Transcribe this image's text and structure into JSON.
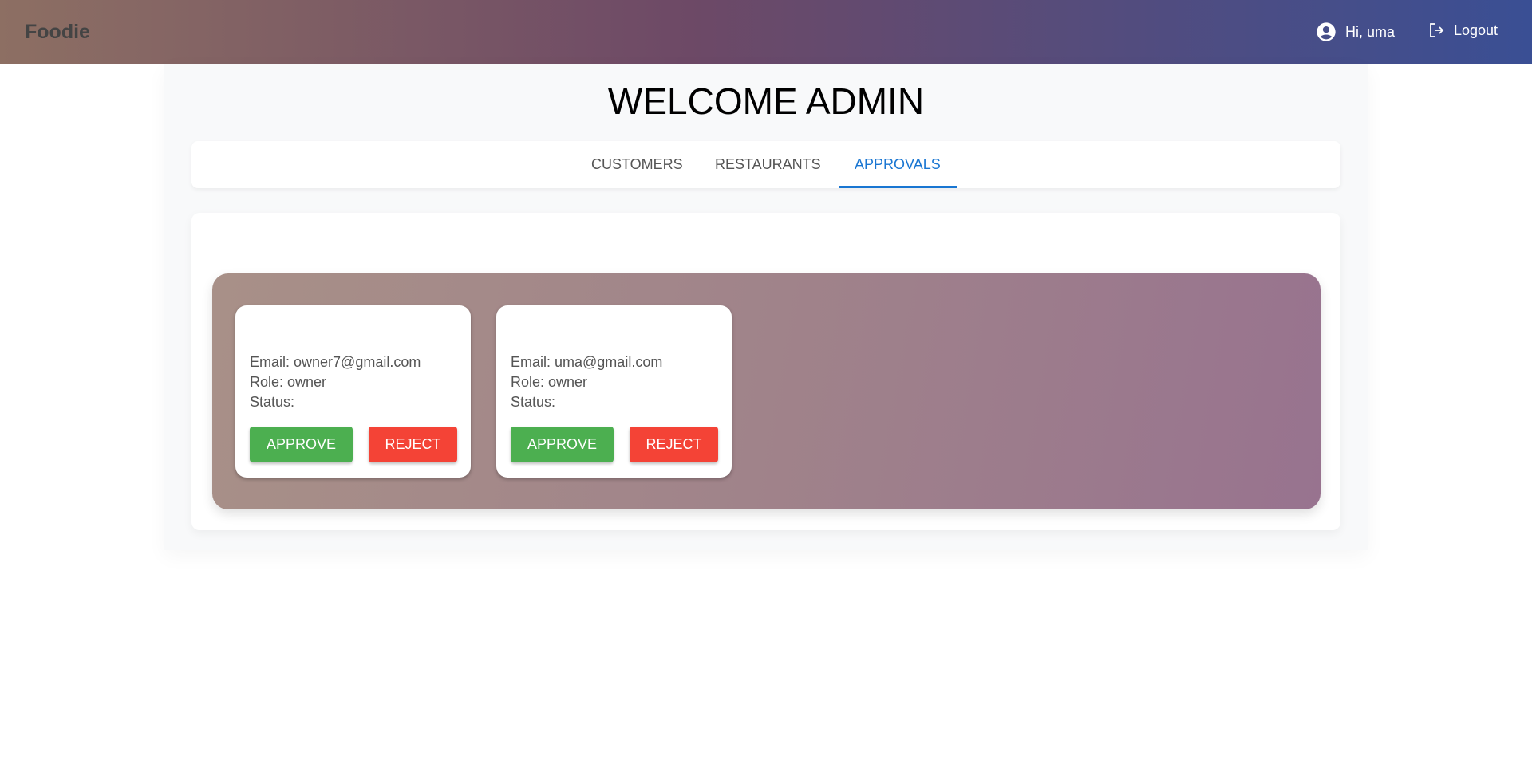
{
  "header": {
    "brand": "Foodie",
    "greeting": "Hi, uma",
    "logout_label": "Logout",
    "gradient": [
      "#8d6f63",
      "#6d4966",
      "#3a4f94"
    ]
  },
  "page": {
    "title": "WELCOME ADMIN"
  },
  "tabs": [
    {
      "label": "CUSTOMERS",
      "active": false
    },
    {
      "label": "RESTAURANTS",
      "active": false
    },
    {
      "label": "APPROVALS",
      "active": true
    }
  ],
  "approvals": [
    {
      "email": "Email: owner7@gmail.com",
      "role": "Role: owner",
      "status": "Status:",
      "approve_label": "APPROVE",
      "reject_label": "REJECT"
    },
    {
      "email": "Email: uma@gmail.com",
      "role": "Role: owner",
      "status": "Status:",
      "approve_label": "APPROVE",
      "reject_label": "REJECT"
    }
  ],
  "colors": {
    "accent": "#1976d2",
    "approve": "#4caf50",
    "reject": "#f44336"
  }
}
